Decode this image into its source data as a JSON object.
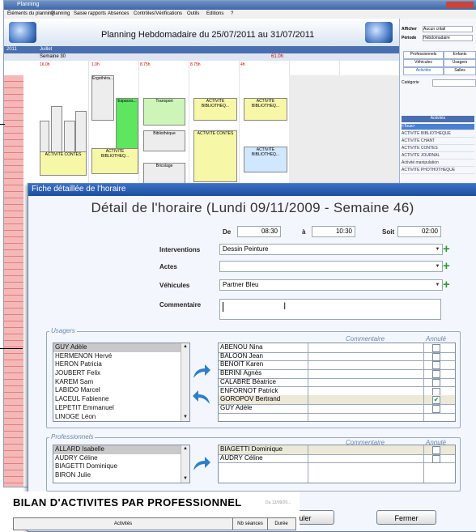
{
  "background_window": {
    "title": "Planning",
    "menu": [
      "Éléments du planning",
      "Planning",
      "Saisie rapports",
      "Absences",
      "Contrôles/Vérifications",
      "Outils",
      "Editions",
      "?"
    ],
    "header_title": "Planning Hebdomadaire du 25/07/2011 au 31/07/2011",
    "year_label": "2011",
    "month_label": "Juillet",
    "week_label": "Semaine 30",
    "week_total": "61.0h",
    "day_totals": [
      "16.0h",
      "1.0h",
      "8.75h",
      "8.75h",
      "4h"
    ],
    "events": [
      {
        "label": "Ergothéra..."
      },
      {
        "label": "Espaces..."
      },
      {
        "label": "Transport"
      },
      {
        "label": "ACTIVITE BIBLIOTHEQ..."
      },
      {
        "label": "ACTIVITE BIBLIOTHEQ..."
      },
      {
        "label": "Bibliothèque"
      },
      {
        "label": "ACTIVITE BIBLIOTHEQ..."
      },
      {
        "label": "ACTIVITE CONTES"
      },
      {
        "label": "ACTIVITE BIBLIOTHEQ..."
      },
      {
        "label": "ACTIVITE CONTES"
      },
      {
        "label": "Bricolage"
      }
    ],
    "right_panel": {
      "afficher_label": "Afficher",
      "afficher_value": "Aucun critail",
      "periode_label": "Période",
      "periode_value": "Hebdomadaire",
      "tabs_row1": [
        "Professionnels",
        "Enfants"
      ],
      "tabs_row2": [
        "Véhicules",
        "Usagers"
      ],
      "tabs_row3": [
        "Activités",
        "Salles"
      ],
      "categorie_label": "Catégorie",
      "activites_header": "Activités",
      "activites": [
        "<Tous>",
        "ACTIVITE BIBLIOTHEQUE",
        "ACTIVITE CHANT",
        "ACTIVITE CONTES",
        "ACTIVITE JOURNAL",
        "Activité manipulation",
        "ACTIVITE PHOTHOTHEQUE"
      ]
    }
  },
  "dialog": {
    "title": "Fiche détaillée de l'horaire",
    "heading": "Détail de l'horaire  (Lundi 09/11/2009 -  Semaine 46)",
    "de_label": "De",
    "de_value": "08:30",
    "a_label": "à",
    "a_value": "10:30",
    "soit_label": "Soit",
    "soit_value": "02:00",
    "interventions_label": "Interventions",
    "interventions_value": "Dessin Peinture",
    "actes_label": "Actes",
    "actes_value": "",
    "vehicules_label": "Véhicules",
    "vehicules_value": "Partner Bleu",
    "commentaire_label": "Commentaire",
    "commentaire_value": "",
    "usagers": {
      "section_title": "Usagers",
      "list": [
        "GUY Adèle",
        "HERMENON Hervé",
        "HERON Patricia",
        "JOUBERT Felix",
        "KAREM Sam",
        "LABIDO Marcel",
        "LACEUL Fabienne",
        "LEPETIT Emmanuel",
        "LINOGE Léon"
      ],
      "selected_index": 0,
      "col_commentaire": "Commentaire",
      "col_annule": "Annulé",
      "assigned": [
        {
          "name": "ABENOU Nina",
          "annule": false
        },
        {
          "name": "BALOON Jean",
          "annule": false
        },
        {
          "name": "BENOIT Karen",
          "annule": false
        },
        {
          "name": "BERINI Agnès",
          "annule": false
        },
        {
          "name": "CALABRE Béatrice",
          "annule": false
        },
        {
          "name": "ENFORNOT Patrick",
          "annule": false
        },
        {
          "name": "GOROPOV Bertrand",
          "annule": true
        },
        {
          "name": "GUY Adèle",
          "annule": false
        }
      ]
    },
    "professionnels": {
      "section_title": "Professionnels",
      "list": [
        "ALLARD Isabelle",
        "AUDRY Céline",
        "BIAGETTI Dominique",
        "BIRON Julie"
      ],
      "selected_index": 0,
      "col_commentaire": "Commentaire",
      "col_annule": "Annulé",
      "assigned": [
        {
          "name": "BIAGETTI Dominique",
          "annule": false
        },
        {
          "name": "AUDRY Céline",
          "annule": false
        }
      ]
    },
    "buttons": {
      "annuler": "nnuler",
      "fermer": "Fermer"
    }
  },
  "report": {
    "title": "BILAN D'ACTIVITES PAR PROFESSIONNEL",
    "subtitle": "Du 13/09/20...",
    "columns": [
      "Activités",
      "Nb séances",
      "Durée"
    ]
  }
}
